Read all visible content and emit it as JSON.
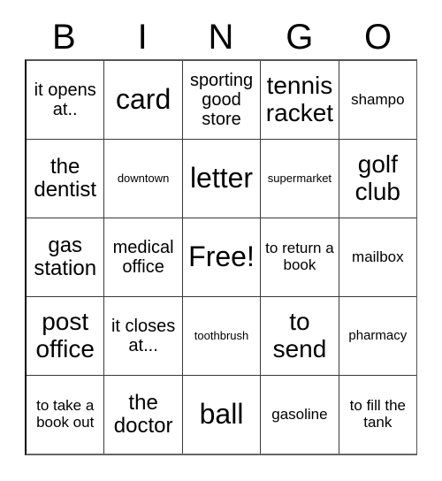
{
  "card": {
    "header": {
      "letters": [
        "B",
        "I",
        "N",
        "G",
        "O"
      ]
    },
    "rows": [
      [
        {
          "text": "it opens at..",
          "size": "fs-lg"
        },
        {
          "text": "card",
          "size": "fs-3xl"
        },
        {
          "text": "sporting good store",
          "size": "fs-lg"
        },
        {
          "text": "tennis racket",
          "size": "fs-2xl"
        },
        {
          "text": "shampo",
          "size": "fs-md"
        }
      ],
      [
        {
          "text": "the dentist",
          "size": "fs-xl"
        },
        {
          "text": "downtown",
          "size": "fs-xs"
        },
        {
          "text": "letter",
          "size": "fs-3xl"
        },
        {
          "text": "supermarket",
          "size": "fs-xs"
        },
        {
          "text": "golf club",
          "size": "fs-2xl"
        }
      ],
      [
        {
          "text": "gas station",
          "size": "fs-xl"
        },
        {
          "text": "medical office",
          "size": "fs-lg"
        },
        {
          "text": "Free!",
          "size": "fs-3xl"
        },
        {
          "text": "to return a book",
          "size": "fs-md"
        },
        {
          "text": "mailbox",
          "size": "fs-md"
        }
      ],
      [
        {
          "text": "post office",
          "size": "fs-2xl"
        },
        {
          "text": "it closes at...",
          "size": "fs-lg"
        },
        {
          "text": "toothbrush",
          "size": "fs-xs"
        },
        {
          "text": "to send",
          "size": "fs-2xl"
        },
        {
          "text": "pharmacy",
          "size": "fs-sm"
        }
      ],
      [
        {
          "text": "to take a book out",
          "size": "fs-md"
        },
        {
          "text": "the doctor",
          "size": "fs-xl"
        },
        {
          "text": "ball",
          "size": "fs-3xl"
        },
        {
          "text": "gasoline",
          "size": "fs-md"
        },
        {
          "text": "to fill the tank",
          "size": "fs-md"
        }
      ]
    ]
  },
  "colors": {
    "background": "#ffffff",
    "text": "#000000",
    "border": "#3a3a3a"
  }
}
